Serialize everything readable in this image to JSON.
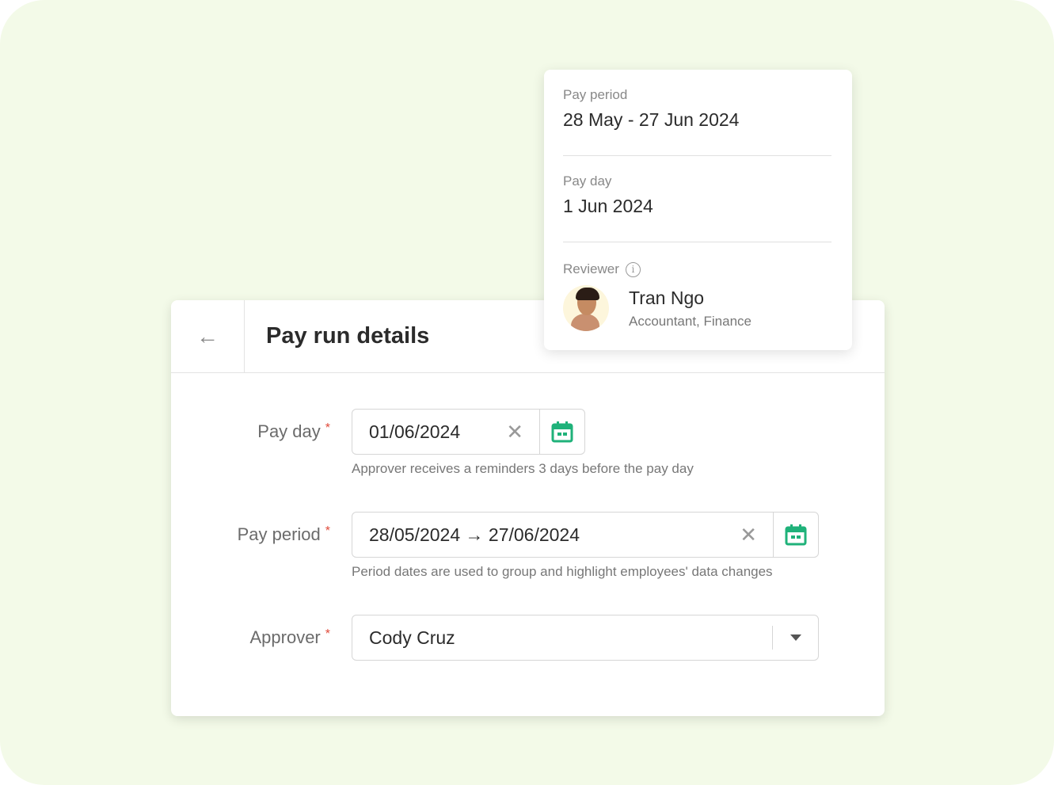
{
  "header": {
    "title": "Pay run details",
    "back_icon": "arrow-left-icon"
  },
  "form": {
    "pay_day": {
      "label": "Pay day",
      "required": "*",
      "value": "01/06/2024",
      "hint": "Approver receives a reminders 3 days before the pay day"
    },
    "pay_period": {
      "label": "Pay period",
      "required": "*",
      "start": "28/05/2024",
      "arrow": "→",
      "end": "27/06/2024",
      "hint": "Period dates are used to group and highlight employees' data changes"
    },
    "approver": {
      "label": "Approver",
      "required": "*",
      "value": "Cody Cruz"
    }
  },
  "summary": {
    "pay_period_label": "Pay period",
    "pay_period_value": "28 May - 27 Jun 2024",
    "pay_day_label": "Pay day",
    "pay_day_value": "1 Jun 2024",
    "reviewer_label": "Reviewer",
    "reviewer_name": "Tran Ngo",
    "reviewer_role": "Accountant, Finance"
  },
  "colors": {
    "accent": "#1fb27a",
    "required": "#e04a3a",
    "background": "#f3fae8"
  }
}
